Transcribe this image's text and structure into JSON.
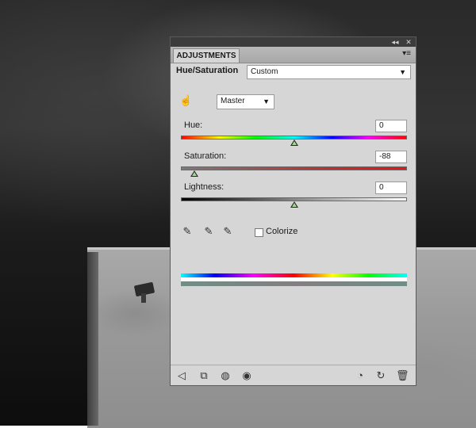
{
  "panel": {
    "tab_label": "ADJUSTMENTS",
    "title": "Hue/Saturation",
    "preset": "Custom",
    "channel": "Master",
    "hue": {
      "label": "Hue:",
      "value": "0",
      "level": 0.5
    },
    "saturation": {
      "label": "Saturation:",
      "value": "-88",
      "level": 0.06
    },
    "lightness": {
      "label": "Lightness:",
      "value": "0",
      "level": 0.5
    },
    "colorize": {
      "label": "Colorize",
      "checked": false
    }
  },
  "icons": {
    "titlebar": [
      "collapse-icon",
      "close-icon"
    ],
    "menu": "panel-menu-icon",
    "hand_tool": "targeted-adjustment-icon",
    "eyedroppers": [
      "eyedropper-icon",
      "eyedropper-add-icon",
      "eyedropper-subtract-icon"
    ],
    "bottom": [
      "return-arrow-icon",
      "clip-layer-icon",
      "visibility-circle-icon",
      "eye-icon",
      "view-previous-icon",
      "reset-icon",
      "trash-icon"
    ]
  },
  "colors": {
    "panel_bg": "#d6d6d6",
    "titlebar": "#3c3c3c",
    "thumb": "#9fdc8f"
  }
}
